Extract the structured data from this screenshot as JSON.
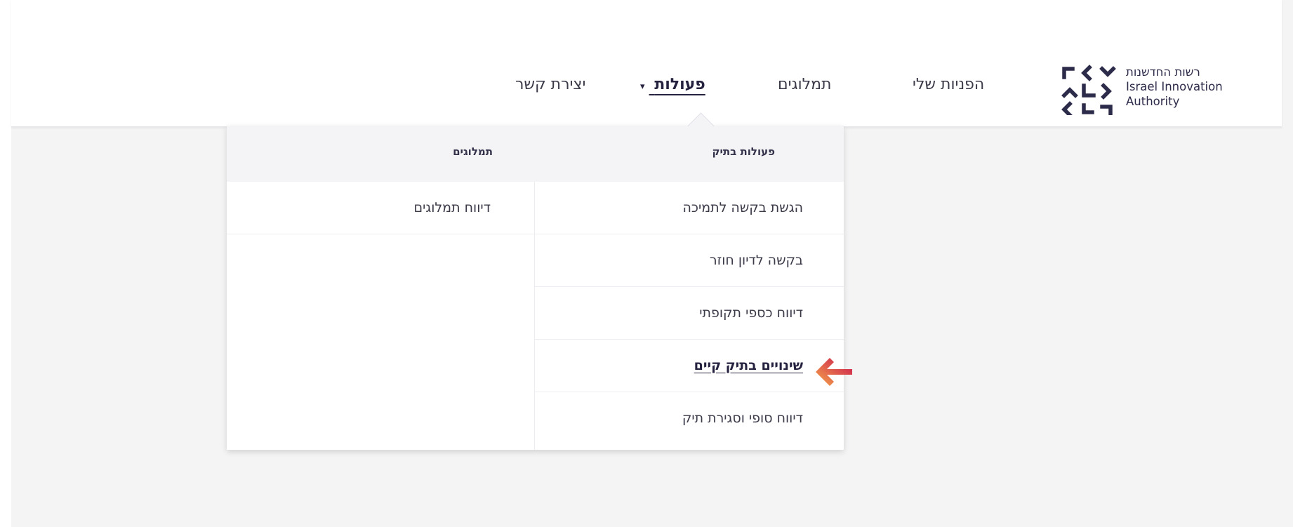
{
  "logo": {
    "hebrew": "רשות החדשנות",
    "line1": "Israel Innovation",
    "line2": "Authority"
  },
  "nav": {
    "my_requests": "הפניות שלי",
    "grants": "תמלוגים",
    "actions": "פעולות",
    "contact": "יצירת קשר"
  },
  "dropdown": {
    "col_actions_title": "פעולות בתיק",
    "col_grants_title": "תמלוגים",
    "actions_items": [
      "הגשת בקשה לתמיכה",
      "בקשה לדיון חוזר",
      "דיווח כספי תקופתי",
      "שינויים בתיק קיים",
      "דיווח סופי וסגירת תיק"
    ],
    "grants_items": [
      "דיווח תמלוגים"
    ]
  },
  "colors": {
    "brand_dark": "#2d2b4a",
    "arrow_start": "#f6a84a",
    "arrow_end": "#c8124f"
  }
}
